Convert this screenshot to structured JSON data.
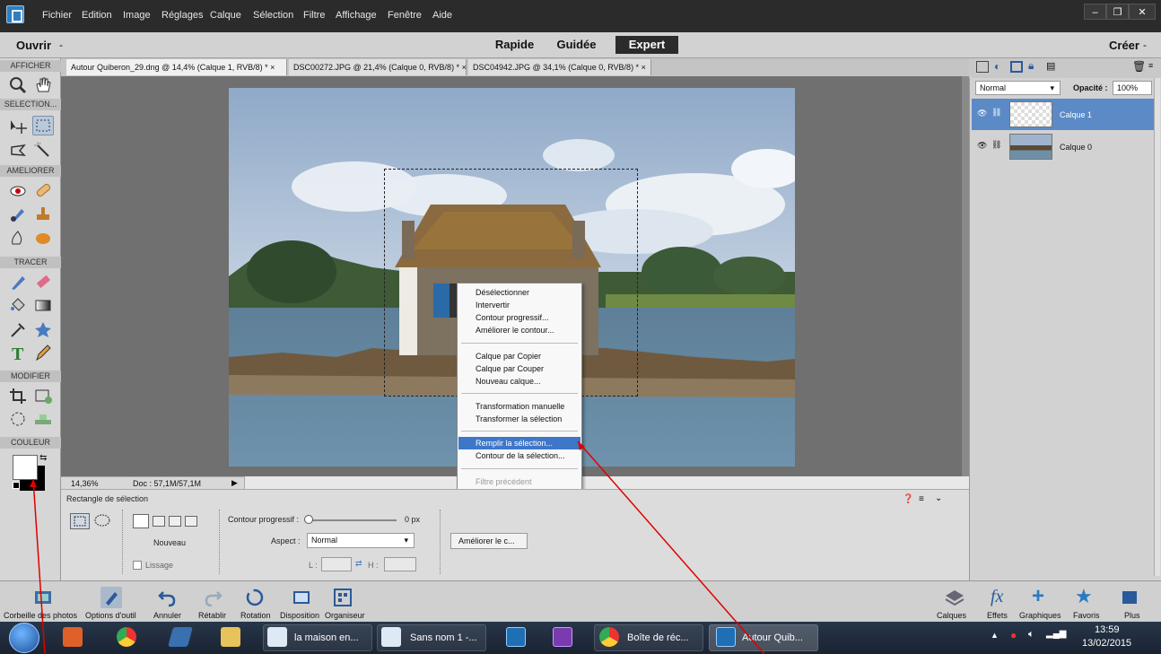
{
  "menubar": {
    "items": [
      "Fichier",
      "Edition",
      "Image",
      "Réglages",
      "Calque",
      "Sélection",
      "Filtre",
      "Affichage",
      "Fenêtre",
      "Aide"
    ]
  },
  "window_buttons": {
    "min": "–",
    "restore": "❐",
    "close": "✕"
  },
  "modebar": {
    "open": "Ouvrir",
    "open_arrow": "-",
    "modes": [
      "Rapide",
      "Guidée",
      "Expert"
    ],
    "active_mode": "Expert",
    "create": "Créer",
    "create_arrow": "-"
  },
  "tabs": [
    "Autour Quiberon_29.dng @ 14,4% (Calque 1, RVB/8) * ×",
    "DSC00272.JPG @ 21,4% (Calque 0, RVB/8) * ×",
    "DSC04942.JPG @ 34,1% (Calque 0, RVB/8) * ×"
  ],
  "toolbox": {
    "sections": [
      "AFFICHER",
      "SELECTION...",
      "AMELIORER",
      "TRACER",
      "MODIFIER",
      "COULEUR"
    ]
  },
  "status": {
    "zoom": "14,36%",
    "doc": "Doc : 57,1M/57,1M"
  },
  "context_menu": {
    "group1": [
      "Désélectionner",
      "Intervertir",
      "Contour progressif...",
      "Améliorer le contour..."
    ],
    "group2": [
      "Calque par Copier",
      "Calque par Couper",
      "Nouveau calque..."
    ],
    "group3": [
      "Transformation manuelle",
      "Transformer la sélection"
    ],
    "group4": [
      "Remplir la sélection...",
      "Contour de la sélection..."
    ],
    "group5": [
      "Filtre précédent"
    ],
    "highlighted": "Remplir la sélection..."
  },
  "options": {
    "title": "Rectangle de sélection",
    "new_label": "Nouveau",
    "smooth_label": "Lissage",
    "feather_label": "Contour progressif :",
    "feather_value": "0 px",
    "aspect_label": "Aspect :",
    "aspect_value": "Normal",
    "w_label": "L :",
    "h_label": "H :",
    "refine_button": "Améliorer le c..."
  },
  "layers_panel": {
    "blend_mode": "Normal",
    "opacity_label": "Opacité :",
    "opacity_value": "100%",
    "layers": [
      {
        "name": "Calque 1",
        "selected": true
      },
      {
        "name": "Calque 0",
        "selected": false
      }
    ]
  },
  "bottombar": {
    "left": [
      "Corbeille des photos",
      "Options d'outil",
      "Annuler",
      "Rétablir",
      "Rotation",
      "Disposition",
      "Organiseur"
    ],
    "right": [
      "Calques",
      "Effets",
      "Graphiques",
      "Favoris",
      "Plus"
    ]
  },
  "taskbar": {
    "items": [
      "la maison en...",
      "Sans nom 1 -...",
      "Boîte de réc...",
      "Autour Quib..."
    ],
    "time": "13:59",
    "date": "13/02/2015"
  },
  "colors": {
    "accent": "#3f77c8",
    "annotation": "#e00000",
    "menubar_bg": "#2b2b2b"
  }
}
